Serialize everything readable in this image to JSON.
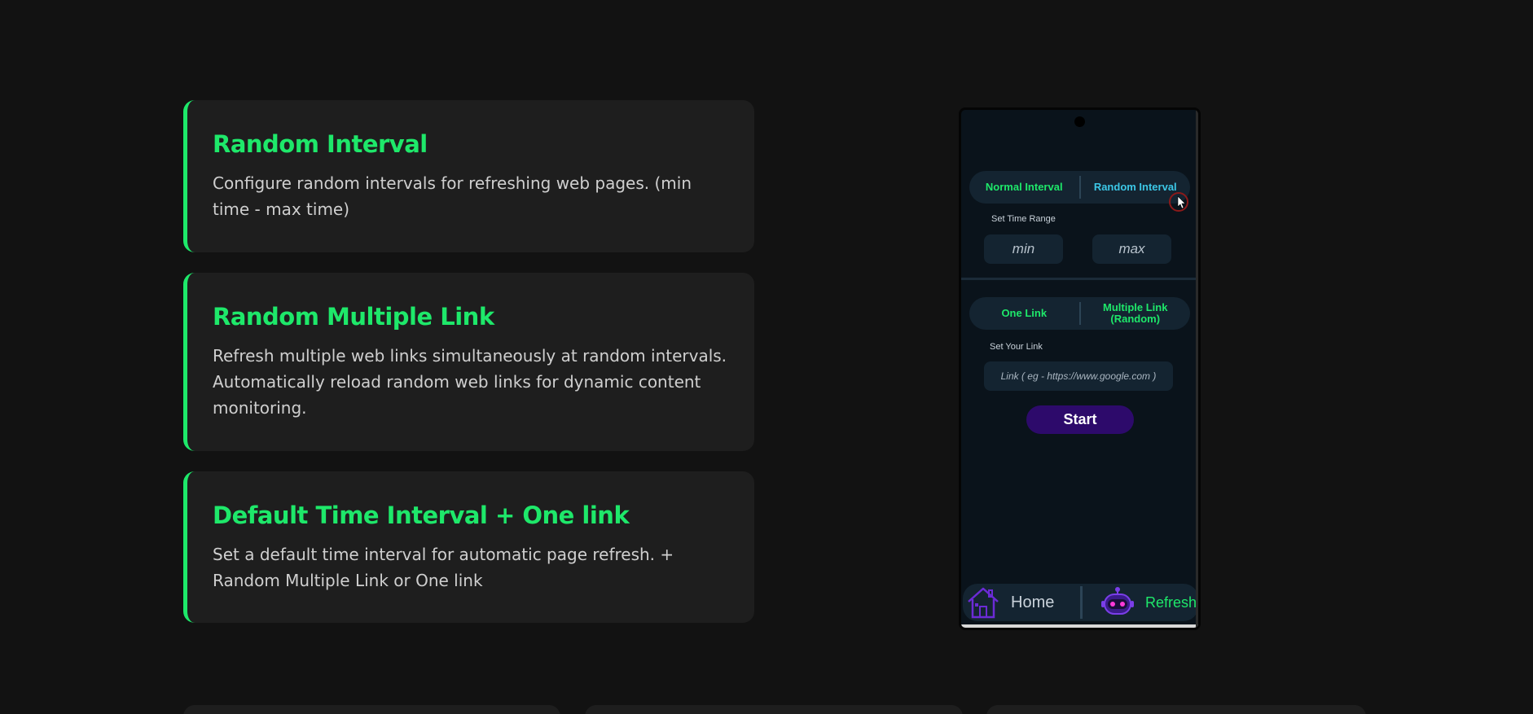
{
  "features": [
    {
      "title": "Random Interval",
      "description": "Configure random intervals for refreshing web pages. (min time - max time)"
    },
    {
      "title": "Random Multiple Link",
      "description": "Refresh multiple web links simultaneously at random intervals. Automatically reload random web links for dynamic content monitoring."
    },
    {
      "title": "Default Time Interval + One link",
      "description": "Set a default time interval for automatic page refresh. + Random Multiple Link or One link"
    }
  ],
  "phone": {
    "interval_tabs": {
      "normal": "Normal Interval",
      "random": "Random Interval"
    },
    "time_range_label": "Set Time Range",
    "min_placeholder": "min",
    "max_placeholder": "max",
    "link_tabs": {
      "one": "One Link",
      "multiple": "Multiple Link (Random)"
    },
    "your_link_label": "Set Your Link",
    "link_placeholder": "Link ( eg - https://www.google.com )",
    "start_label": "Start",
    "nav": {
      "home": "Home",
      "refresh": "Refresh"
    }
  },
  "colors": {
    "accent": "#1ee86a",
    "background": "#121212",
    "card": "#1e1e1e",
    "phone_bg": "#0a131b",
    "start_button": "#2d0a6b",
    "random_tab": "#3cc7e6"
  },
  "icons": [
    "house-icon",
    "robot-icon",
    "cursor-icon"
  ]
}
